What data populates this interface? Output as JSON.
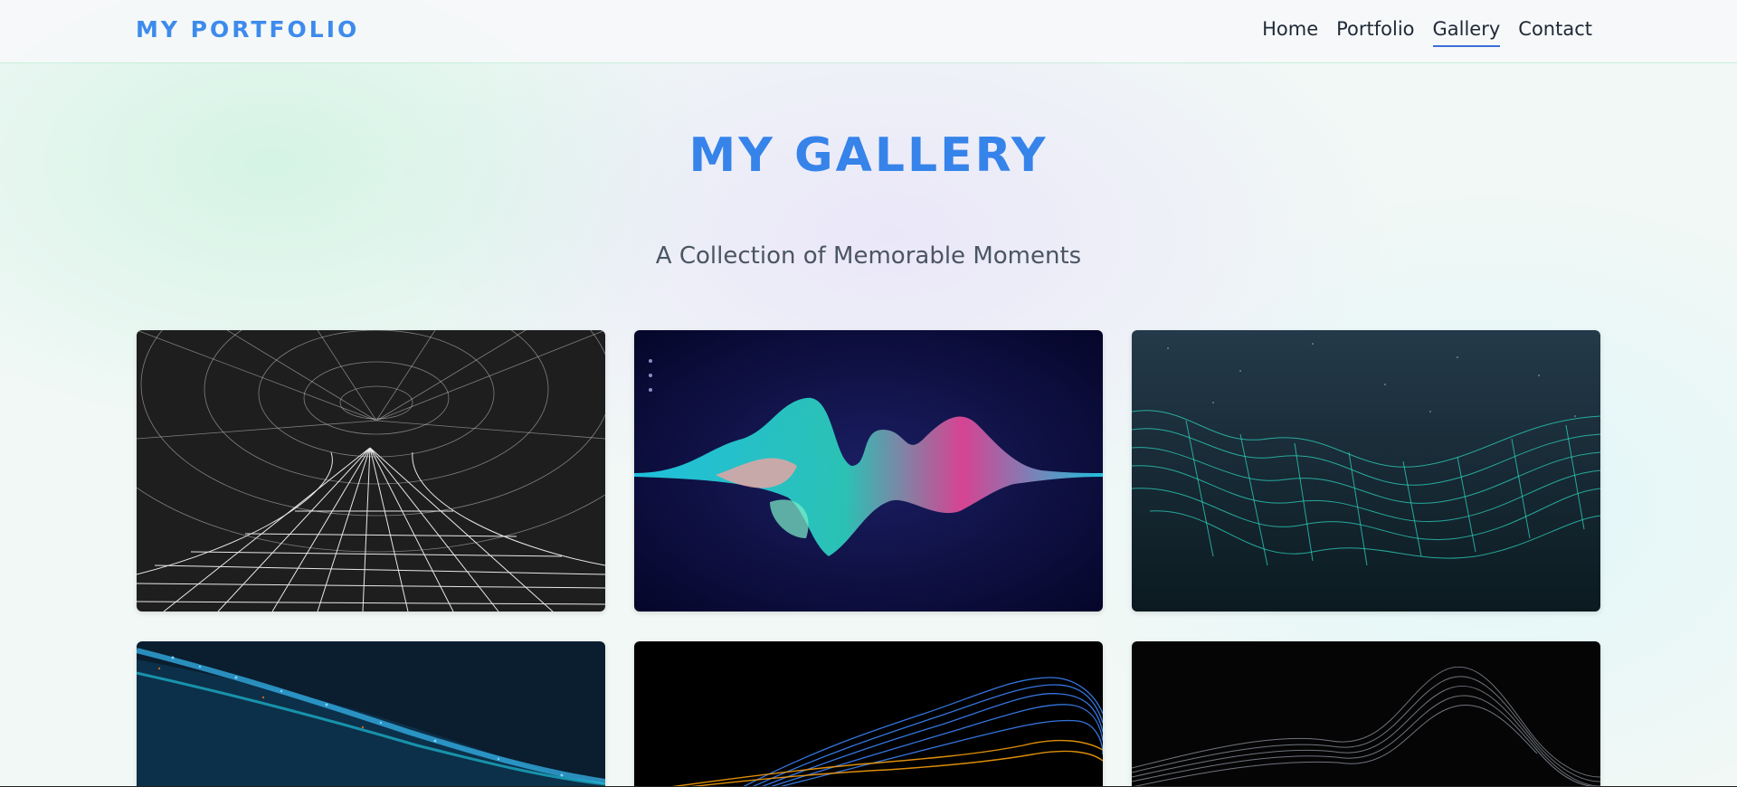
{
  "navbar": {
    "brand": "MY PORTFOLIO",
    "links": [
      "Home",
      "Portfolio",
      "Gallery",
      "Contact"
    ],
    "active_link": "Gallery"
  },
  "hero": {
    "title": "MY GALLERY",
    "subtitle": "A Collection of Memorable Moments"
  },
  "gallery": {
    "items": [
      {
        "subject": "wireframe-wormhole"
      },
      {
        "subject": "neon-sound-wave"
      },
      {
        "subject": "teal-mesh-landscape"
      },
      {
        "subject": "blue-particle-wave"
      },
      {
        "subject": "orange-blue-line-waves"
      },
      {
        "subject": "gray-line-waves"
      }
    ]
  },
  "colors": {
    "accent": "#3d8bec",
    "nav_active_underline": "#3b6fd8",
    "text_dark": "#1f2937",
    "subtitle": "#4b5563"
  }
}
